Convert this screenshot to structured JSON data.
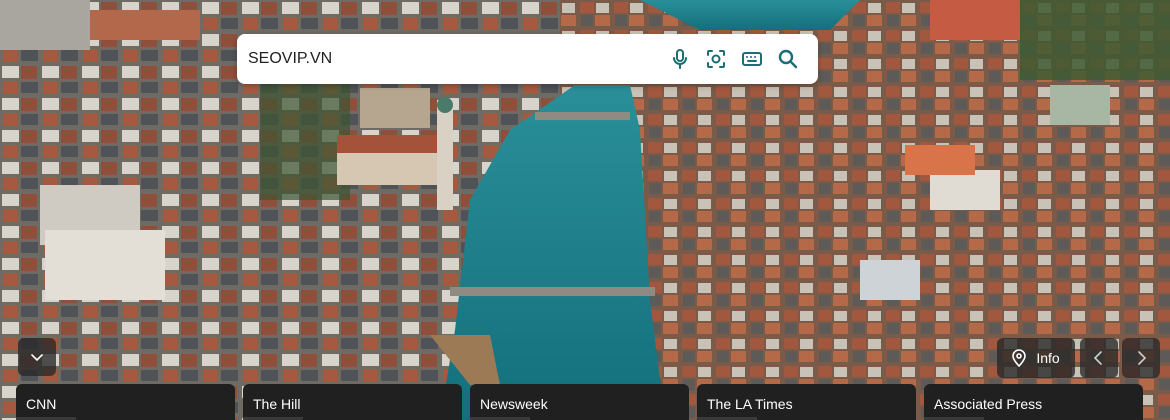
{
  "search": {
    "value": "SEOVIP.VN",
    "icons": [
      "microphone-icon",
      "visual-search-icon",
      "keyboard-icon",
      "search-icon"
    ]
  },
  "collapse": {
    "icon": "chevron-down-icon"
  },
  "info": {
    "label": "Info",
    "icon": "location-pin-icon"
  },
  "carousel": {
    "prev_icon": "chevron-left-icon",
    "next_icon": "chevron-right-icon"
  },
  "news": {
    "items": [
      {
        "label": "CNN"
      },
      {
        "label": "The Hill"
      },
      {
        "label": "Newsweek"
      },
      {
        "label": "The LA Times"
      },
      {
        "label": "Associated Press"
      }
    ]
  },
  "colors": {
    "water": "#1e7f8a",
    "roofs": "#8a4b36",
    "panel": "#202020",
    "accent": "#ffffff"
  }
}
